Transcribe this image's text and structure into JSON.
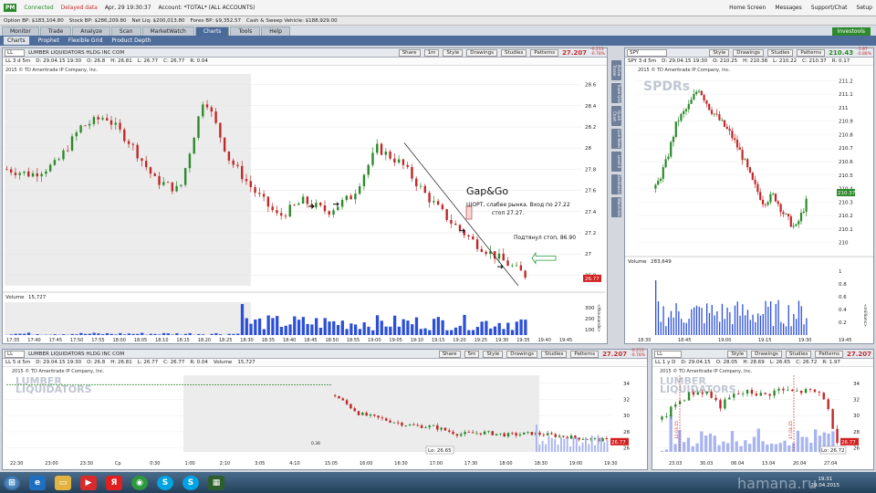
{
  "topbar": {
    "badge": "PM",
    "connected": "Connected",
    "delayed": "Delayed data",
    "datetime": "Apr, 29 19:30:37",
    "account": "Account: *TOTAL* (ALL ACCOUNTS)",
    "home": "Home Screen",
    "messages": "Messages",
    "support": "Support/Chat",
    "setup": "Setup"
  },
  "balances": [
    "Option BP: $183,104.80",
    "Stock BP: $286,209.80",
    "Net Liq: $200,013.80",
    "Forex BP: $9,352.57",
    "Cash & Sweep Vehicle: $188,929.00"
  ],
  "tabs": [
    "Monitor",
    "Trade",
    "Analyze",
    "Scan",
    "MarketWatch",
    "Charts",
    "Tools",
    "Help"
  ],
  "active_tab": "Charts",
  "investools": "Investools",
  "subtabs": [
    "Charts",
    "Prophet",
    "Flexible Grid",
    "Product Depth"
  ],
  "main_chart": {
    "symbol": "LL",
    "company": "LUMBER LIQUIDATORS HLDG INC COM",
    "period": "LL 3 d 5m",
    "ohlc": [
      "D: 29.04.15 19:30",
      "O: 26.8",
      "H: 26.81",
      "L: 26.77",
      "C: 26.77",
      "R: 0.04"
    ],
    "last": "27.207",
    "change": "-0.213",
    "change_pct": "-0.78%",
    "toolbar": [
      "Share",
      "1m",
      "Style",
      "Drawings",
      "Studies",
      "Patterns"
    ],
    "copyright": "2015 © TD Ameritrade IP Company, Inc.",
    "price_ticks": [
      "28.6",
      "28.4",
      "28.2",
      "28",
      "27.8",
      "27.6",
      "27.4",
      "27.2",
      "27",
      "26.8"
    ],
    "current_label": "26.77",
    "time_ticks": [
      "17:35",
      "17:40",
      "17:45",
      "17:50",
      "17:55",
      "18:00",
      "18:05",
      "18:10",
      "18:15",
      "18:20",
      "18:25",
      "18:30",
      "18:35",
      "18:40",
      "18:45",
      "18:50",
      "18:55",
      "19:00",
      "19:05",
      "19:10",
      "19:15",
      "19:20",
      "19:25",
      "19:30",
      "19:35",
      "19:40",
      "19:45"
    ],
    "volume_label": "Volume",
    "volume_value": "15,727",
    "volume_ticks": [
      "300",
      "200",
      "100"
    ],
    "volume_unit": "<thousands>",
    "annotation_title": "Gap&Go",
    "annotation_1": "ШОРТ, слабее рынка. Вход по 27.22",
    "annotation_2": "стоп 27.27.",
    "annotation_3": "Подтянул стоп, 86.90"
  },
  "spy_chart": {
    "symbol": "SPY",
    "period": "SPY 3 d 5m",
    "ohlc": [
      "D: 29.04.15 19:30",
      "O: 210.25",
      "H: 210.38",
      "L: 210.22",
      "C: 210.37",
      "R: 0.17"
    ],
    "last": "210.43",
    "change": "-1.87",
    "change_pct": "-0.88%",
    "toolbar": [
      "Style",
      "Drawings",
      "Studies",
      "Patterns"
    ],
    "copyright": "2015 © TD Ameritrade IP Company, Inc.",
    "brand": "SPDRs",
    "price_ticks": [
      "211.2",
      "211.1",
      "211",
      "210.9",
      "210.8",
      "210.7",
      "210.6",
      "210.5",
      "210.4",
      "210.3",
      "210.2",
      "210.1",
      "210"
    ],
    "current_label": "210.37",
    "time_ticks": [
      "18:30",
      "18:45",
      "19:00",
      "19:15",
      "19:30",
      "19:45"
    ],
    "volume_label": "Volume",
    "volume_value": "283,649",
    "volume_ticks": [
      "1",
      "0.8",
      "0.6",
      "0.4",
      "0.2"
    ],
    "volume_unit": "<millions>",
    "side_buttons": [
      "Active Trader",
      "Trade Grid",
      "Quick Chart",
      "Live News",
      "Level II",
      "Dashboard",
      "Watchlists"
    ]
  },
  "bottom_left": {
    "symbol": "LL",
    "company": "LUMBER LIQUIDATORS HLDG INC COM",
    "period": "LL 5 d 5m",
    "ohlc": [
      "D: 29.04.15 19:30",
      "O: 26.8",
      "H: 26.81",
      "L: 26.77",
      "C: 26.77",
      "R: 0.04",
      "Volume",
      "15,727"
    ],
    "last": "27.207",
    "change": "-0.213",
    "change_pct": "-0.78%",
    "toolbar": [
      "Share",
      "5m",
      "Style",
      "Drawings",
      "Studies",
      "Patterns"
    ],
    "copyright": "2015 © TD Ameritrade IP Company, Inc.",
    "price_ticks": [
      "34",
      "32",
      "30",
      "28",
      "26"
    ],
    "current_label": "26.77",
    "low_label": "Lo: 26.65",
    "hi_label": "0.36",
    "time_ticks": [
      "22:30",
      "23:00",
      "23:30",
      "Ср",
      "0:30",
      "1:00",
      "2:10",
      "3:05",
      "4:10",
      "15:05",
      "16:00",
      "16:30",
      "17:00",
      "17:30",
      "18:00",
      "18:30",
      "19:00",
      "19:30"
    ]
  },
  "bottom_right": {
    "symbol": "LL",
    "period": "LL 1 y D",
    "ohlc": [
      "D: 29.04.15",
      "O: 28.05",
      "H: 28.69",
      "L: 26.65",
      "C: 26.72",
      "R: 1.97"
    ],
    "last": "27.207",
    "change": "-0.213",
    "change_pct": "-0.78%",
    "toolbar": [
      "Style",
      "Drawings",
      "Studies",
      "Patterns"
    ],
    "copyright": "2015 © TD Ameritrade IP Company, Inc.",
    "price_ticks": [
      "34",
      "32",
      "30",
      "28",
      "26"
    ],
    "current_label": "26.77",
    "low_label": "Lo: 26.72",
    "vline_label_1": "12.03.15",
    "vline_label_2": "17.04.15",
    "time_ticks": [
      "23.03",
      "30.03",
      "06.04",
      "13.04",
      "20.04",
      "27.04"
    ]
  },
  "taskbar": {
    "time": "19:31",
    "date": "29.04.2015"
  },
  "site_watermark": "hamana.ru"
}
